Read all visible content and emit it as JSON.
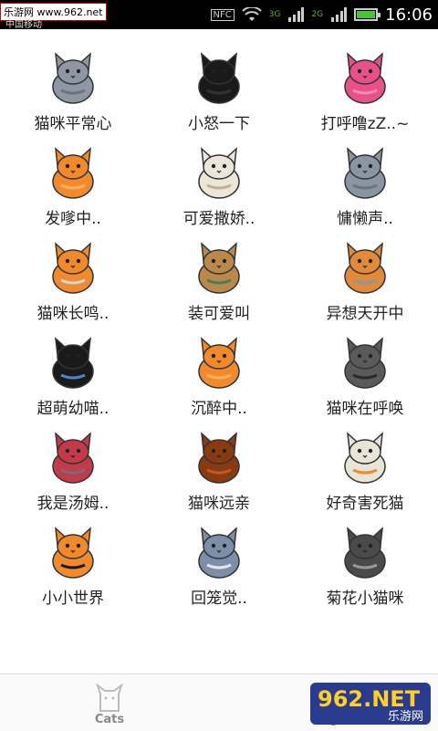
{
  "status": {
    "watermark": "乐游网 www.962.net",
    "carrier": "中国移动",
    "nfc": "NFC",
    "network1": "3G",
    "network2": "2G",
    "time": "16:06"
  },
  "items": [
    {
      "label": "猫咪平常心",
      "icon": "gray-cat-sitting-icon"
    },
    {
      "label": "小怒一下",
      "icon": "black-cat-angry-icon"
    },
    {
      "label": "打呼噜zZ..~",
      "icon": "pink-cat-sleeping-icon"
    },
    {
      "label": "发嗲中..",
      "icon": "orange-cat-fish-icon"
    },
    {
      "label": "可爱撒娇..",
      "icon": "white-cat-icon"
    },
    {
      "label": "慵懒声..",
      "icon": "gray-cat-lying-icon"
    },
    {
      "label": "猫咪长鸣..",
      "icon": "orange-cat-cage-icon"
    },
    {
      "label": "装可爱叫",
      "icon": "cat-in-box-icon"
    },
    {
      "label": "异想天开中",
      "icon": "cat-yarn-icon"
    },
    {
      "label": "超萌幼喵..",
      "icon": "black-cat-litter-icon"
    },
    {
      "label": "沉醉中..",
      "icon": "orange-cat-standing-icon"
    },
    {
      "label": "猫咪在呼唤",
      "icon": "tabby-cat-jumping-icon"
    },
    {
      "label": "我是汤姆..",
      "icon": "cat-in-basket-icon"
    },
    {
      "label": "猫咪远亲",
      "icon": "lion-icon"
    },
    {
      "label": "好奇害死猫",
      "icon": "cat-in-toilet-icon"
    },
    {
      "label": "小小世界",
      "icon": "cat-in-pumpkin-icon"
    },
    {
      "label": "回笼觉..",
      "icon": "cat-on-laptop-icon"
    },
    {
      "label": "菊花小猫咪",
      "icon": "gray-cat-back-icon"
    }
  ],
  "tabs": [
    {
      "label": "Cats",
      "icon": "cat-tab-icon"
    },
    {
      "label": "Dogs",
      "icon": "dog-tab-icon"
    }
  ],
  "logo": {
    "big": "962.NET",
    "small": "乐游网"
  },
  "colors": {
    "orange": "#f08a2c",
    "gray": "#7d8590",
    "black": "#1a1a1a",
    "pink": "#e8508a"
  }
}
